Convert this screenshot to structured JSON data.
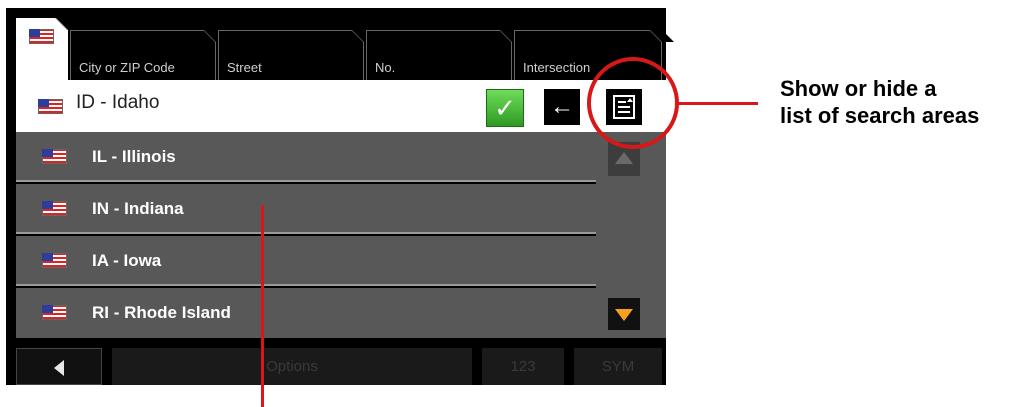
{
  "tabs": [
    {
      "label": ""
    },
    {
      "label": "City or ZIP Code"
    },
    {
      "label": "Street"
    },
    {
      "label": "No."
    },
    {
      "label": "Intersection"
    }
  ],
  "header": {
    "label": "ID - Idaho"
  },
  "list": [
    {
      "label": "IL - Illinois"
    },
    {
      "label": "IN - Indiana"
    },
    {
      "label": "IA - Iowa"
    },
    {
      "label": "RI - Rhode Island"
    }
  ],
  "bottom": {
    "options": "Options",
    "num": "123",
    "sym": "SYM"
  },
  "annotation": {
    "line1": "Show or hide a",
    "line2": "list of search areas"
  },
  "colors": {
    "accent": "#d81818",
    "ok": "#3dbb2c",
    "scroll_arrow": "#f5a21a"
  },
  "icons": [
    "us-flag-icon",
    "check-icon",
    "back-arrow-icon",
    "list-toggle-icon",
    "scroll-up-icon",
    "scroll-down-icon",
    "left-arrow-icon"
  ]
}
